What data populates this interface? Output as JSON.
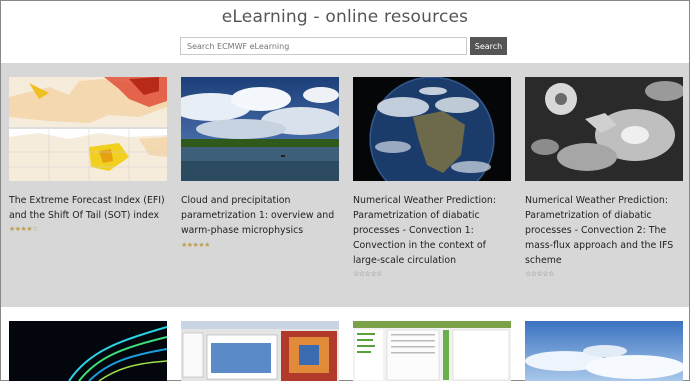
{
  "header": {
    "title": "eLearning - online resources"
  },
  "search": {
    "placeholder": "Search ECMWF eLearning",
    "button_label": "Search"
  },
  "courses": [
    {
      "title": "The Extreme Forecast Index (EFI) and the Shift Of Tail (SOT) index",
      "rating": 4,
      "max_rating": 5
    },
    {
      "title": "Cloud and precipitation parametrization 1: overview and warm-phase microphysics",
      "rating": 5,
      "max_rating": 5
    },
    {
      "title": "Numerical Weather Prediction: Parametrization of diabatic processes - Convection 1: Convection in the context of large-scale circulation",
      "rating": 0,
      "max_rating": 5
    },
    {
      "title": "Numerical Weather Prediction: Parametrization of diabatic processes - Convection 2: The mass-flux approach and the IFS scheme",
      "rating": 0,
      "max_rating": 5
    }
  ],
  "colors": {
    "page_bg": "#d7d7d7",
    "button_bg": "#555555",
    "star_filled": "#bfa052",
    "star_empty": "#777777"
  }
}
